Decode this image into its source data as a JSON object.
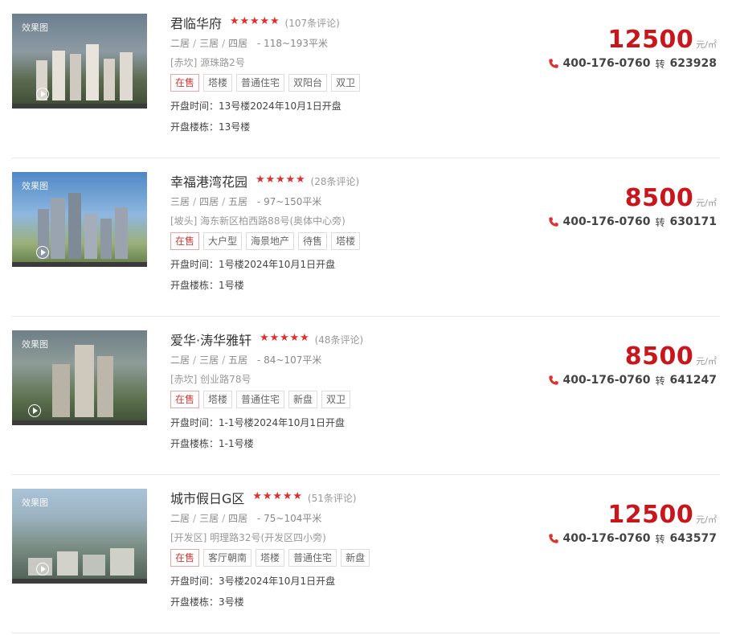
{
  "accent": "#c8161d",
  "listings": [
    {
      "thumb_tag": "效果图",
      "name": "君临华府",
      "rating": 5,
      "reviews": "(107条评论)",
      "rooms": [
        "二居",
        "三居",
        "四居"
      ],
      "area": "- 118~193平米",
      "address": "[赤坎] 源珠路2号",
      "tags": [
        "在售",
        "塔楼",
        "普通住宅",
        "双阳台",
        "双卫"
      ],
      "open_time": "开盘时间：13号楼2024年10月1日开盘",
      "open_building": "开盘楼栋：13号楼",
      "price": "12500",
      "price_unit": "元/㎡",
      "phone": "400-176-0760",
      "zhuan": "转",
      "ext": "623928"
    },
    {
      "thumb_tag": "效果图",
      "name": "幸福港湾花园",
      "rating": 5,
      "reviews": "(28条评论)",
      "rooms": [
        "三居",
        "四居",
        "五居"
      ],
      "area": "- 97~150平米",
      "address": "[坡头] 海东新区柏西路88号(奥体中心旁)",
      "tags": [
        "在售",
        "大户型",
        "海景地产",
        "待售",
        "塔楼"
      ],
      "open_time": "开盘时间：1号楼2024年10月1日开盘",
      "open_building": "开盘楼栋：1号楼",
      "price": "8500",
      "price_unit": "元/㎡",
      "phone": "400-176-0760",
      "zhuan": "转",
      "ext": "630171"
    },
    {
      "thumb_tag": "效果图",
      "name": "爱华·涛华雅轩",
      "rating": 5,
      "reviews": "(48条评论)",
      "rooms": [
        "二居",
        "三居",
        "五居"
      ],
      "area": "- 84~107平米",
      "address": "[赤坎] 创业路78号",
      "tags": [
        "在售",
        "塔楼",
        "普通住宅",
        "新盘",
        "双卫"
      ],
      "open_time": "开盘时间：1-1号楼2024年10月1日开盘",
      "open_building": "开盘楼栋：1-1号楼",
      "price": "8500",
      "price_unit": "元/㎡",
      "phone": "400-176-0760",
      "zhuan": "转",
      "ext": "641247"
    },
    {
      "thumb_tag": "效果图",
      "name": "城市假日G区",
      "rating": 5,
      "reviews": "(51条评论)",
      "rooms": [
        "二居",
        "三居",
        "四居"
      ],
      "area": "- 75~104平米",
      "address": "[开发区] 明理路32号(开发区四小旁)",
      "tags": [
        "在售",
        "客厅朝南",
        "塔楼",
        "普通住宅",
        "新盘"
      ],
      "open_time": "开盘时间：3号楼2024年10月1日开盘",
      "open_building": "开盘楼栋：3号楼",
      "price": "12500",
      "price_unit": "元/㎡",
      "phone": "400-176-0760",
      "zhuan": "转",
      "ext": "643577"
    }
  ]
}
